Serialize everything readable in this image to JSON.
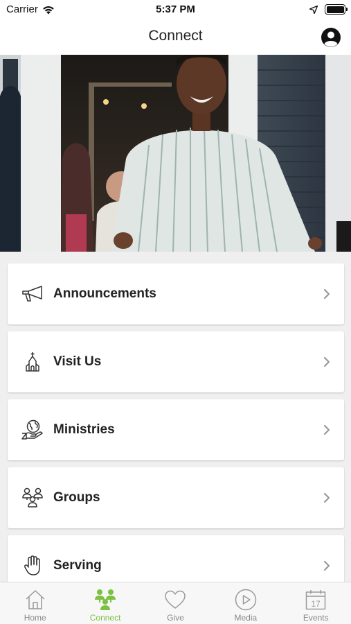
{
  "status_bar": {
    "carrier": "Carrier",
    "time": "5:37 PM"
  },
  "nav": {
    "title": "Connect"
  },
  "menu": {
    "items": [
      {
        "label": "Announcements",
        "icon": "megaphone-icon"
      },
      {
        "label": "Visit Us",
        "icon": "church-icon"
      },
      {
        "label": "Ministries",
        "icon": "globe-in-hand-icon"
      },
      {
        "label": "Groups",
        "icon": "group-icon"
      },
      {
        "label": "Serving",
        "icon": "hand-icon"
      }
    ]
  },
  "tabs": [
    {
      "label": "Home",
      "icon": "home-icon"
    },
    {
      "label": "Connect",
      "icon": "connect-people-icon",
      "active": true
    },
    {
      "label": "Give",
      "icon": "heart-icon"
    },
    {
      "label": "Media",
      "icon": "play-icon"
    },
    {
      "label": "Events",
      "icon": "calendar-icon",
      "date": "17"
    }
  ],
  "colors": {
    "accent": "#7cc242",
    "inactive": "#888888",
    "background": "#efefef"
  }
}
